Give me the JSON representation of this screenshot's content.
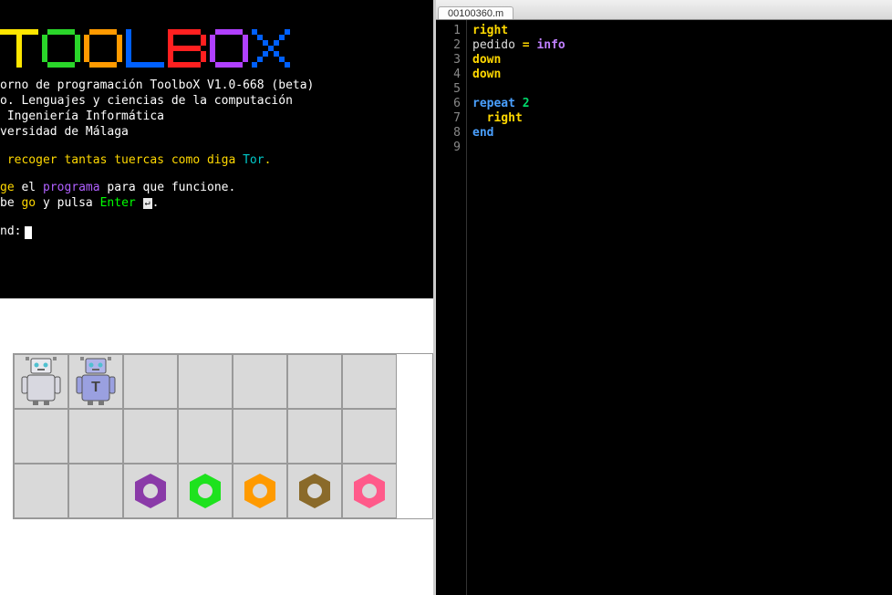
{
  "logo": {
    "letters": [
      {
        "char": "T",
        "color": "#ffe600"
      },
      {
        "char": "O",
        "color": "#2ad62a"
      },
      {
        "char": "O",
        "color": "#ff9a00"
      },
      {
        "char": "L",
        "color": "#0060ff"
      },
      {
        "char": "B",
        "color": "#ff2020"
      },
      {
        "char": "O",
        "color": "#b040ff"
      },
      {
        "char": "X",
        "color": "#0060ff"
      }
    ]
  },
  "info": {
    "line1": "orno de programación ToolboX V1.0-668 (beta)",
    "line2": "o. Lenguajes y ciencias de la computación",
    "line3": " Ingeniería Informática",
    "line4": "versidad de Málaga"
  },
  "task": {
    "prefix": " recoger tantas tuercas como diga ",
    "target": "Tor",
    "suffix": "."
  },
  "help1": {
    "a": "ge",
    "b": " el ",
    "c": "programa",
    "d": " para que funcione."
  },
  "help2": {
    "a": "be ",
    "b": "go",
    "c": " y pulsa ",
    "d": "Enter",
    "e": "."
  },
  "enter_symbol": "↵",
  "prompt": {
    "label": "nd:"
  },
  "board": {
    "cols": 7,
    "rows": 3,
    "robots": [
      {
        "row": 0,
        "col": 0,
        "kind": "gray"
      },
      {
        "row": 0,
        "col": 1,
        "kind": "tor"
      }
    ],
    "nuts": [
      {
        "row": 2,
        "col": 2,
        "color": "#8a3aa8"
      },
      {
        "row": 2,
        "col": 3,
        "color": "#1ee21e"
      },
      {
        "row": 2,
        "col": 4,
        "color": "#ff9a00"
      },
      {
        "row": 2,
        "col": 5,
        "color": "#8a6a2a"
      },
      {
        "row": 2,
        "col": 6,
        "color": "#ff5a8a"
      }
    ]
  },
  "editor": {
    "filename": "00100360.m",
    "lines": [
      {
        "n": 1,
        "tokens": [
          {
            "t": "right",
            "c": "kw-cmd"
          }
        ]
      },
      {
        "n": 2,
        "tokens": [
          {
            "t": "pedido ",
            "c": "kw-ident"
          },
          {
            "t": "=",
            "c": "kw-op"
          },
          {
            "t": " ",
            "c": ""
          },
          {
            "t": "info",
            "c": "kw-func"
          }
        ]
      },
      {
        "n": 3,
        "tokens": [
          {
            "t": "down",
            "c": "kw-cmd"
          }
        ]
      },
      {
        "n": 4,
        "tokens": [
          {
            "t": "down",
            "c": "kw-cmd"
          }
        ]
      },
      {
        "n": 5,
        "tokens": []
      },
      {
        "n": 6,
        "tokens": [
          {
            "t": "repeat ",
            "c": "kw-ctrl"
          },
          {
            "t": "2",
            "c": "kw-num"
          }
        ]
      },
      {
        "n": 7,
        "tokens": [
          {
            "t": "  ",
            "c": ""
          },
          {
            "t": "right",
            "c": "kw-cmd"
          }
        ]
      },
      {
        "n": 8,
        "tokens": [
          {
            "t": "end",
            "c": "kw-ctrl"
          }
        ]
      },
      {
        "n": 9,
        "tokens": []
      }
    ]
  }
}
